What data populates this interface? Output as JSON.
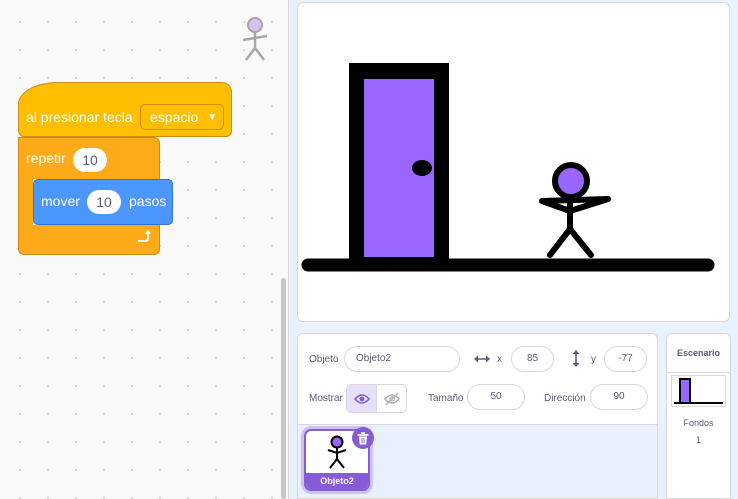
{
  "code": {
    "hat_label": "al presionar tecla",
    "key_option": "espacio",
    "repeat_label": "repetir",
    "repeat_count": "10",
    "move_label": "mover",
    "move_steps": "10",
    "move_unit": "pasos"
  },
  "sprite_info": {
    "object_label": "Objeto",
    "name": "Objeto2",
    "x_label": "x",
    "x": "85",
    "y_label": "y",
    "y": "-77",
    "show_label": "Mostrar",
    "size_label": "Tamaño",
    "size": "50",
    "direction_label": "Dirección",
    "direction": "90"
  },
  "sprites": [
    {
      "name": "Objeto2"
    }
  ],
  "stage_panel": {
    "title": "Escenario",
    "backdrops_label": "Fondos",
    "backdrops_count": "1"
  },
  "colors": {
    "events": "#ffbf00",
    "control": "#ffab19",
    "motion": "#4c97ff",
    "door": "#9966ff",
    "accent": "#855cd6"
  }
}
